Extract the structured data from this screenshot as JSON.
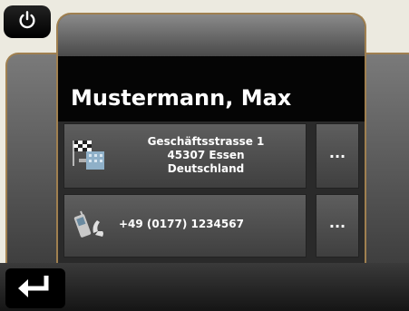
{
  "contact": {
    "name": "Mustermann, Max",
    "address": {
      "line1": "Geschäftsstrasse 1",
      "line2": "45307 Essen",
      "line3": "Deutschland"
    },
    "phone": "+49 (0177) 1234567"
  },
  "buttons": {
    "more_label": "···"
  },
  "icons": {
    "power": "power-icon",
    "address": "building-flag-icon",
    "phone": "phone-icon",
    "back": "back-arrow-icon"
  },
  "colors": {
    "frame_border": "#a08050",
    "background": "#eceae0",
    "row_bg": "#4e4e4e"
  }
}
